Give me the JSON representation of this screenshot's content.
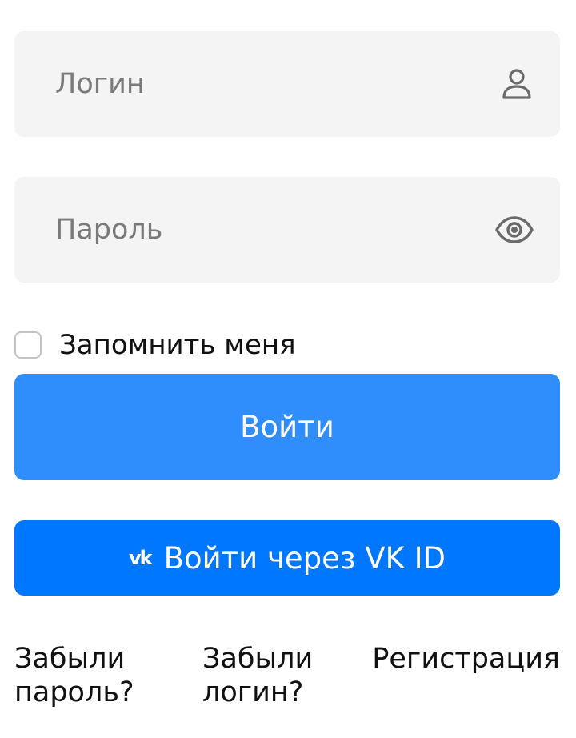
{
  "form": {
    "login": {
      "placeholder": "Логин",
      "value": "",
      "icon": "user-icon"
    },
    "password": {
      "placeholder": "Пароль",
      "value": "",
      "icon": "eye-icon"
    },
    "remember_label": "Запомнить меня",
    "remember_checked": false,
    "login_button_label": "Войти",
    "vk_button_label": "Войти через VK ID",
    "vk_icon_text": "vk"
  },
  "links": {
    "forgot_password": "Забыли пароль?",
    "forgot_login": "Забыли логин?",
    "register": "Регистрация"
  },
  "colors": {
    "field_bg": "#f4f4f4",
    "primary": "#2f8efb",
    "vk_blue": "#0077ff",
    "icon_gray": "#6a6a6a"
  }
}
